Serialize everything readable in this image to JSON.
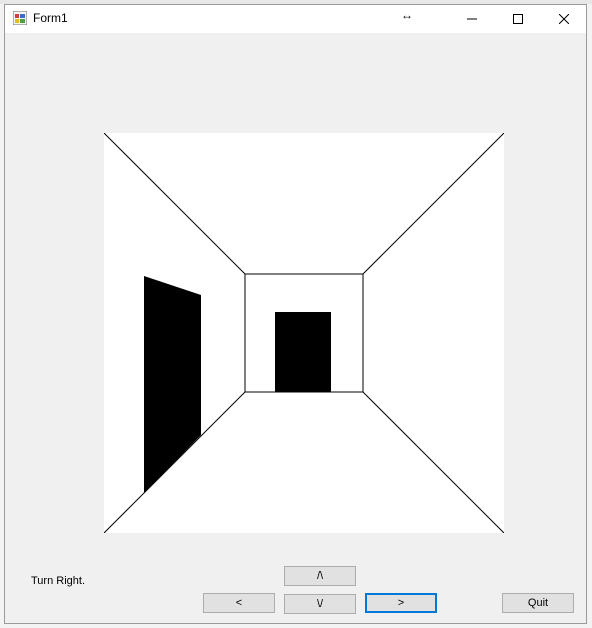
{
  "window": {
    "title": "Form1",
    "icon": "winforms-app-icon",
    "controls": {
      "minimize": "minimize-icon",
      "maximize": "maximize-icon",
      "close": "close-icon"
    }
  },
  "cursor": "horizontal-resize-cursor",
  "status": {
    "text": "Turn Right."
  },
  "buttons": {
    "forward": "/\\",
    "back": "\\/",
    "left": "<",
    "right": ">",
    "quit": "Quit"
  },
  "colors": {
    "canvas": "#ffffff",
    "wall_line": "#000000",
    "door_fill": "#000000",
    "focus_border": "#0078d7"
  }
}
